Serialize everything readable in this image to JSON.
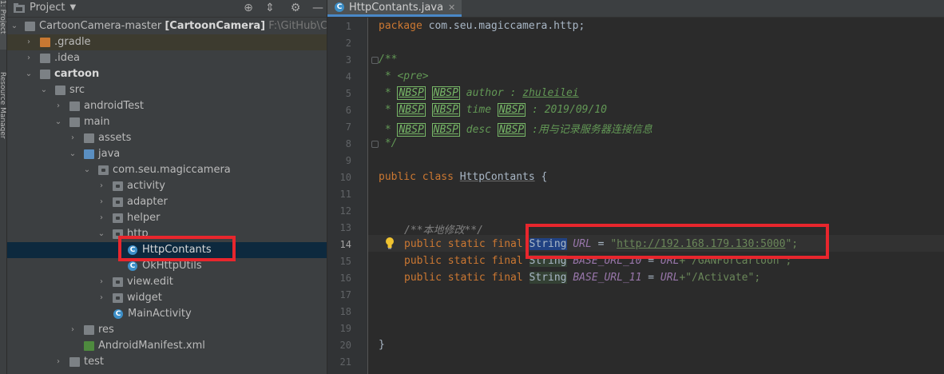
{
  "sidebar_strip": {
    "project_tab": "1: Project",
    "resource_tab": "Resource Manager"
  },
  "project_panel": {
    "title": "Project",
    "tree": [
      {
        "label": "CartoonCamera-master",
        "module": "[CartoonCamera]",
        "path": "F:\\GitHub\\CartoonC"
      },
      {
        "label": ".gradle"
      },
      {
        "label": ".idea"
      },
      {
        "label": "cartoon"
      },
      {
        "label": "src"
      },
      {
        "label": "androidTest"
      },
      {
        "label": "main"
      },
      {
        "label": "assets"
      },
      {
        "label": "java"
      },
      {
        "label": "com.seu.magiccamera"
      },
      {
        "label": "activity"
      },
      {
        "label": "adapter"
      },
      {
        "label": "helper"
      },
      {
        "label": "http"
      },
      {
        "label": "HttpContants"
      },
      {
        "label": "OkHttpUtils"
      },
      {
        "label": "view.edit"
      },
      {
        "label": "widget"
      },
      {
        "label": "MainActivity"
      },
      {
        "label": "res"
      },
      {
        "label": "AndroidManifest.xml"
      },
      {
        "label": "test"
      }
    ]
  },
  "editor": {
    "tab_label": "HttpContants.java",
    "current_line": 14,
    "line_numbers": [
      "1",
      "2",
      "3",
      "4",
      "5",
      "6",
      "7",
      "8",
      "9",
      "10",
      "11",
      "12",
      "13",
      "14",
      "15",
      "16",
      "17",
      "18",
      "19",
      "20",
      "21"
    ],
    "code": {
      "l1_kw": "package",
      "l1_rest": " com.seu.magiccamera.http;",
      "l3": "/**",
      "l4_star": " * ",
      "l4_tag": "<pre>",
      "nbsp": "NBSP",
      "l5_text": " author : ",
      "l5_name": "zhuleilei",
      "l6_text": " time ",
      "l6_rest": " : 2019/09/10",
      "l7_text": " desc ",
      "l7_rest": " :用与记录服务器连接信息",
      "l8": " */",
      "l10_kw": "public class",
      "l10_name": "HttpContants",
      "l10_brace": " {",
      "l13": "/**本地修改**/",
      "decl_kw": "public static final",
      "type": "String",
      "l14_field": "URL",
      "l14_eq": " = ",
      "l14_url": "http://192.168.179.130:5000",
      "l14_end": "\";",
      "l15_field": "BASE_URL_10",
      "l15_eq": " = ",
      "l15_ref": "URL",
      "l15_str": "+\"/GANForCartoon\";",
      "l16_field": "BASE_URL_11",
      "l16_eq": " = ",
      "l16_ref": "URL",
      "l16_str": "+\"/Activate\";",
      "l20": "}"
    }
  },
  "colors": {
    "annotation_red": "#e8262d",
    "selection_blue": "#0d293e"
  }
}
